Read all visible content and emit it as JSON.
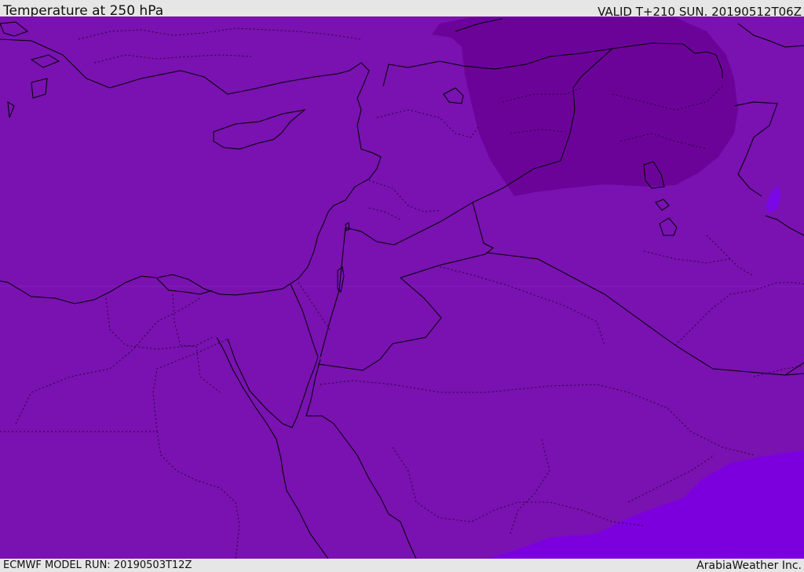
{
  "header": {
    "title": "Temperature at 250 hPa",
    "valid_time": "VALID T+210 SUN. 20190512T06Z"
  },
  "footer": {
    "model_run": "ECMWF MODEL RUN: 20190503T12Z",
    "credit": "ArabiaWeather Inc."
  },
  "map": {
    "colors": {
      "base_field": "#7912b0",
      "cold_core": "#6b0399",
      "warm_area": "#7c00de",
      "warm_lake": "#7a08e6",
      "coastline": "#000000",
      "border": "#000000",
      "frame_bg": "#e6e6e6"
    }
  }
}
